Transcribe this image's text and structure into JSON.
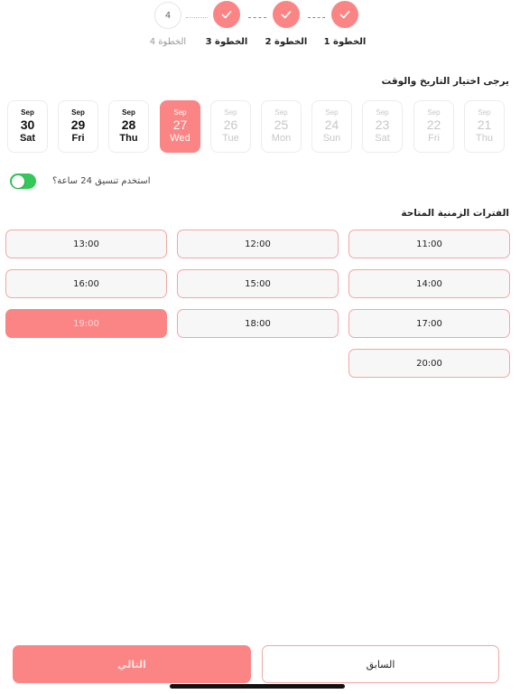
{
  "stepper": {
    "steps": [
      {
        "label": "الخطوة 1",
        "state": "done",
        "icon": "check-icon"
      },
      {
        "label": "الخطوة 2",
        "state": "done",
        "icon": "check-icon"
      },
      {
        "label": "الخطوة 3",
        "state": "done",
        "icon": "check-icon"
      },
      {
        "label": "الخطوة 4",
        "state": "pending",
        "number": "4"
      }
    ]
  },
  "date_section": {
    "title": "يرجى اختيار التاريخ والوقت",
    "dates": [
      {
        "month": "Sep",
        "day": "30",
        "weekday": "Sat",
        "state": "enabled"
      },
      {
        "month": "Sep",
        "day": "29",
        "weekday": "Fri",
        "state": "enabled"
      },
      {
        "month": "Sep",
        "day": "28",
        "weekday": "Thu",
        "state": "enabled"
      },
      {
        "month": "Sep",
        "day": "27",
        "weekday": "Wed",
        "state": "selected"
      },
      {
        "month": "Sep",
        "day": "26",
        "weekday": "Tue",
        "state": "disabled"
      },
      {
        "month": "Sep",
        "day": "25",
        "weekday": "Mon",
        "state": "disabled"
      },
      {
        "month": "Sep",
        "day": "24",
        "weekday": "Sun",
        "state": "disabled"
      },
      {
        "month": "Sep",
        "day": "23",
        "weekday": "Sat",
        "state": "disabled"
      },
      {
        "month": "Sep",
        "day": "22",
        "weekday": "Fri",
        "state": "disabled"
      },
      {
        "month": "Sep",
        "day": "21",
        "weekday": "Thu",
        "state": "disabled"
      }
    ]
  },
  "format_toggle": {
    "label": "استخدم تنسيق 24 ساعة؟",
    "on": true
  },
  "slots_section": {
    "title": "الفترات الزمنية المتاحة",
    "slots": [
      "11:00",
      "12:00",
      "13:00",
      "14:00",
      "15:00",
      "16:00",
      "17:00",
      "18:00",
      "19:00",
      "20:00"
    ],
    "selected": "19:00"
  },
  "footer": {
    "next_label": "التالي",
    "prev_label": "السابق"
  },
  "colors": {
    "accent": "#fb8585",
    "toggle_on": "#34c759",
    "slot_border": "#f3a6a6"
  }
}
